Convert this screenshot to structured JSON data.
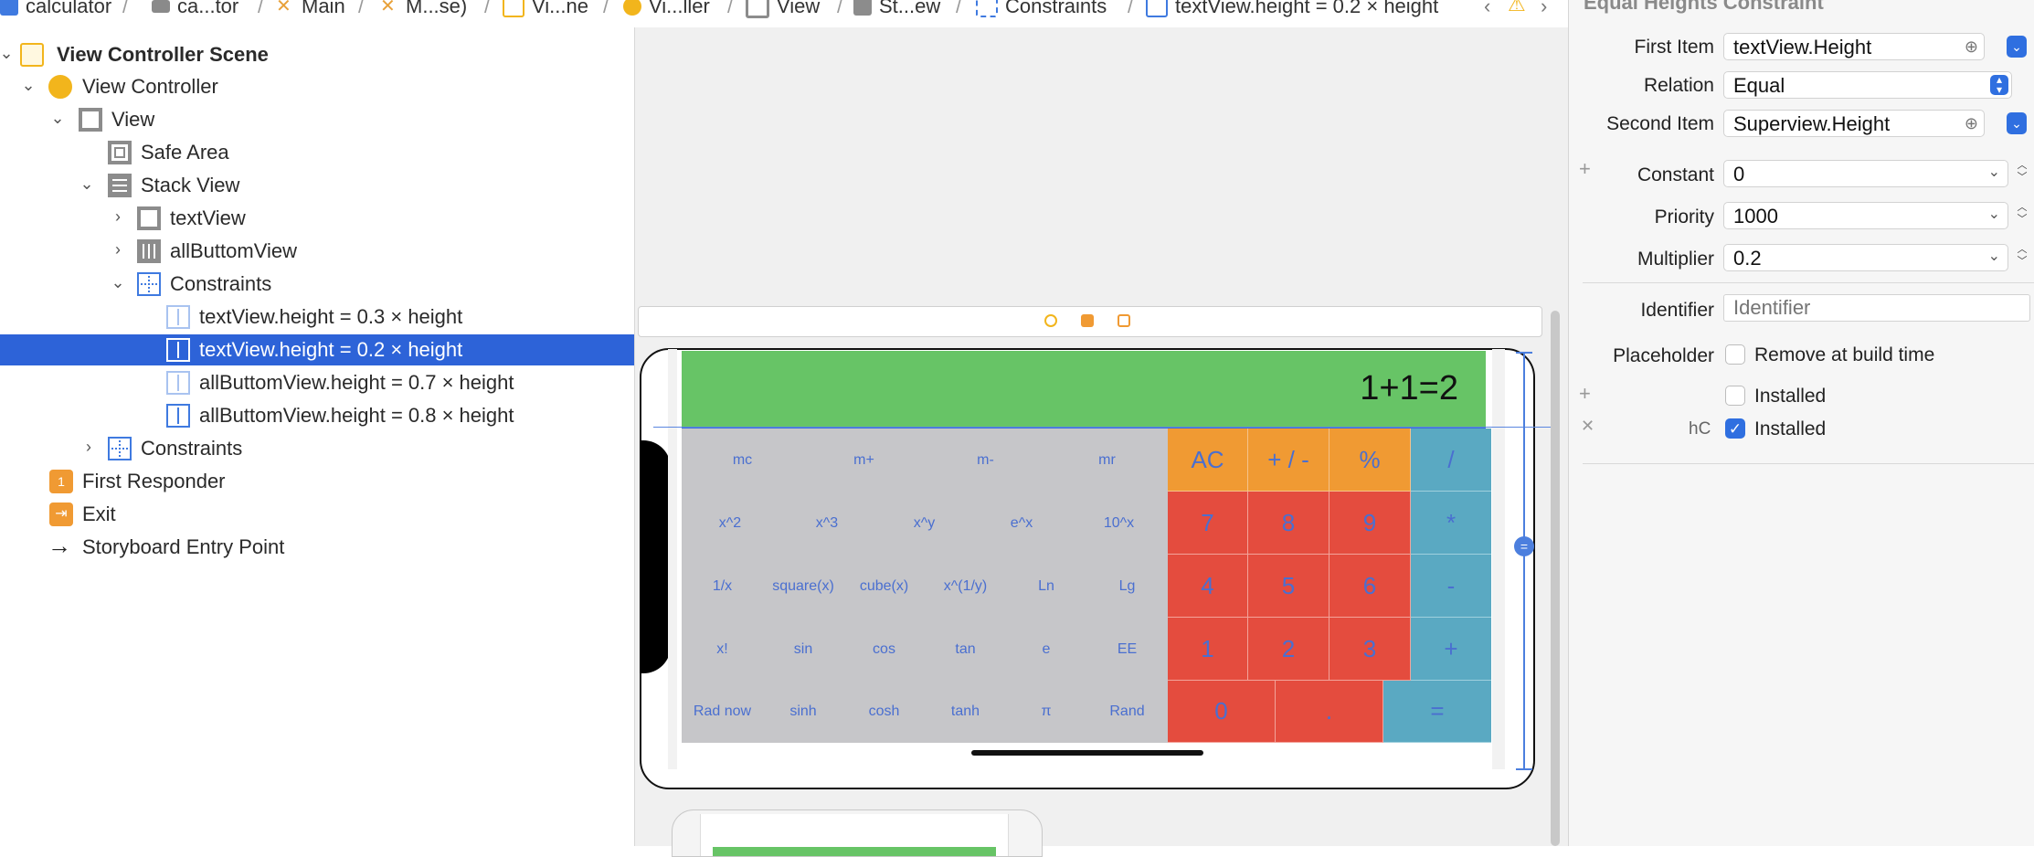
{
  "breadcrumb": [
    "calculator",
    "ca...tor",
    "Main",
    "M...se)",
    "Vi...ne",
    "Vi...ller",
    "View",
    "St...ew",
    "Constraints",
    "textView.height = 0.2 × height"
  ],
  "outline": {
    "items": [
      {
        "label": "View Controller Scene",
        "bold": true
      },
      {
        "label": "View Controller"
      },
      {
        "label": "View"
      },
      {
        "label": "Safe Area"
      },
      {
        "label": "Stack View"
      },
      {
        "label": "textView"
      },
      {
        "label": "allButtomView"
      },
      {
        "label": "Constraints"
      },
      {
        "label": "textView.height = 0.3 × height"
      },
      {
        "label": "textView.height = 0.2 × height",
        "selected": true
      },
      {
        "label": "allButtomView.height = 0.7 × height"
      },
      {
        "label": "allButtomView.height = 0.8 × height"
      },
      {
        "label": "Constraints"
      },
      {
        "label": "First Responder"
      },
      {
        "label": "Exit"
      },
      {
        "label": "Storyboard Entry Point"
      }
    ]
  },
  "calculator": {
    "display": "1+1=2",
    "memory_keys": [
      "mc",
      "m+",
      "m-",
      "mr"
    ],
    "sci_rows": [
      [
        "x^2",
        "x^3",
        "x^y",
        "e^x",
        "10^x"
      ],
      [
        "1/x",
        "square(x)",
        "cube(x)",
        "x^(1/y)",
        "Ln",
        "Lg"
      ],
      [
        "x!",
        "sin",
        "cos",
        "tan",
        "e",
        "EE"
      ],
      [
        "Rad now",
        "sinh",
        "cosh",
        "tanh",
        "π",
        "Rand"
      ]
    ],
    "orange_keys": [
      "AC",
      "+ / -",
      "%"
    ],
    "op_keys": [
      "/",
      "*",
      "-",
      "+",
      "="
    ],
    "digit_rows": [
      [
        "7",
        "8",
        "9"
      ],
      [
        "4",
        "5",
        "6"
      ],
      [
        "1",
        "2",
        "3"
      ]
    ],
    "bottom_keys": [
      "0",
      "."
    ]
  },
  "inspector": {
    "title": "Equal Heights Constraint",
    "first_item_label": "First Item",
    "first_item_value": "textView.Height",
    "relation_label": "Relation",
    "relation_value": "Equal",
    "second_item_label": "Second Item",
    "second_item_value": "Superview.Height",
    "constant_label": "Constant",
    "constant_value": "0",
    "priority_label": "Priority",
    "priority_value": "1000",
    "multiplier_label": "Multiplier",
    "multiplier_value": "0.2",
    "identifier_label": "Identifier",
    "identifier_placeholder": "Identifier",
    "placeholder_label": "Placeholder",
    "remove_at_build_label": "Remove at build time",
    "installed_label_1": "Installed",
    "size_class": "hC",
    "installed_label_2": "Installed"
  },
  "colors": {
    "selection": "#2d63d8",
    "display_green": "#67c466",
    "button_gray": "#c6c6c9",
    "orange": "#f09a33",
    "red": "#e44c3e",
    "blue_op": "#5aa9c2"
  }
}
